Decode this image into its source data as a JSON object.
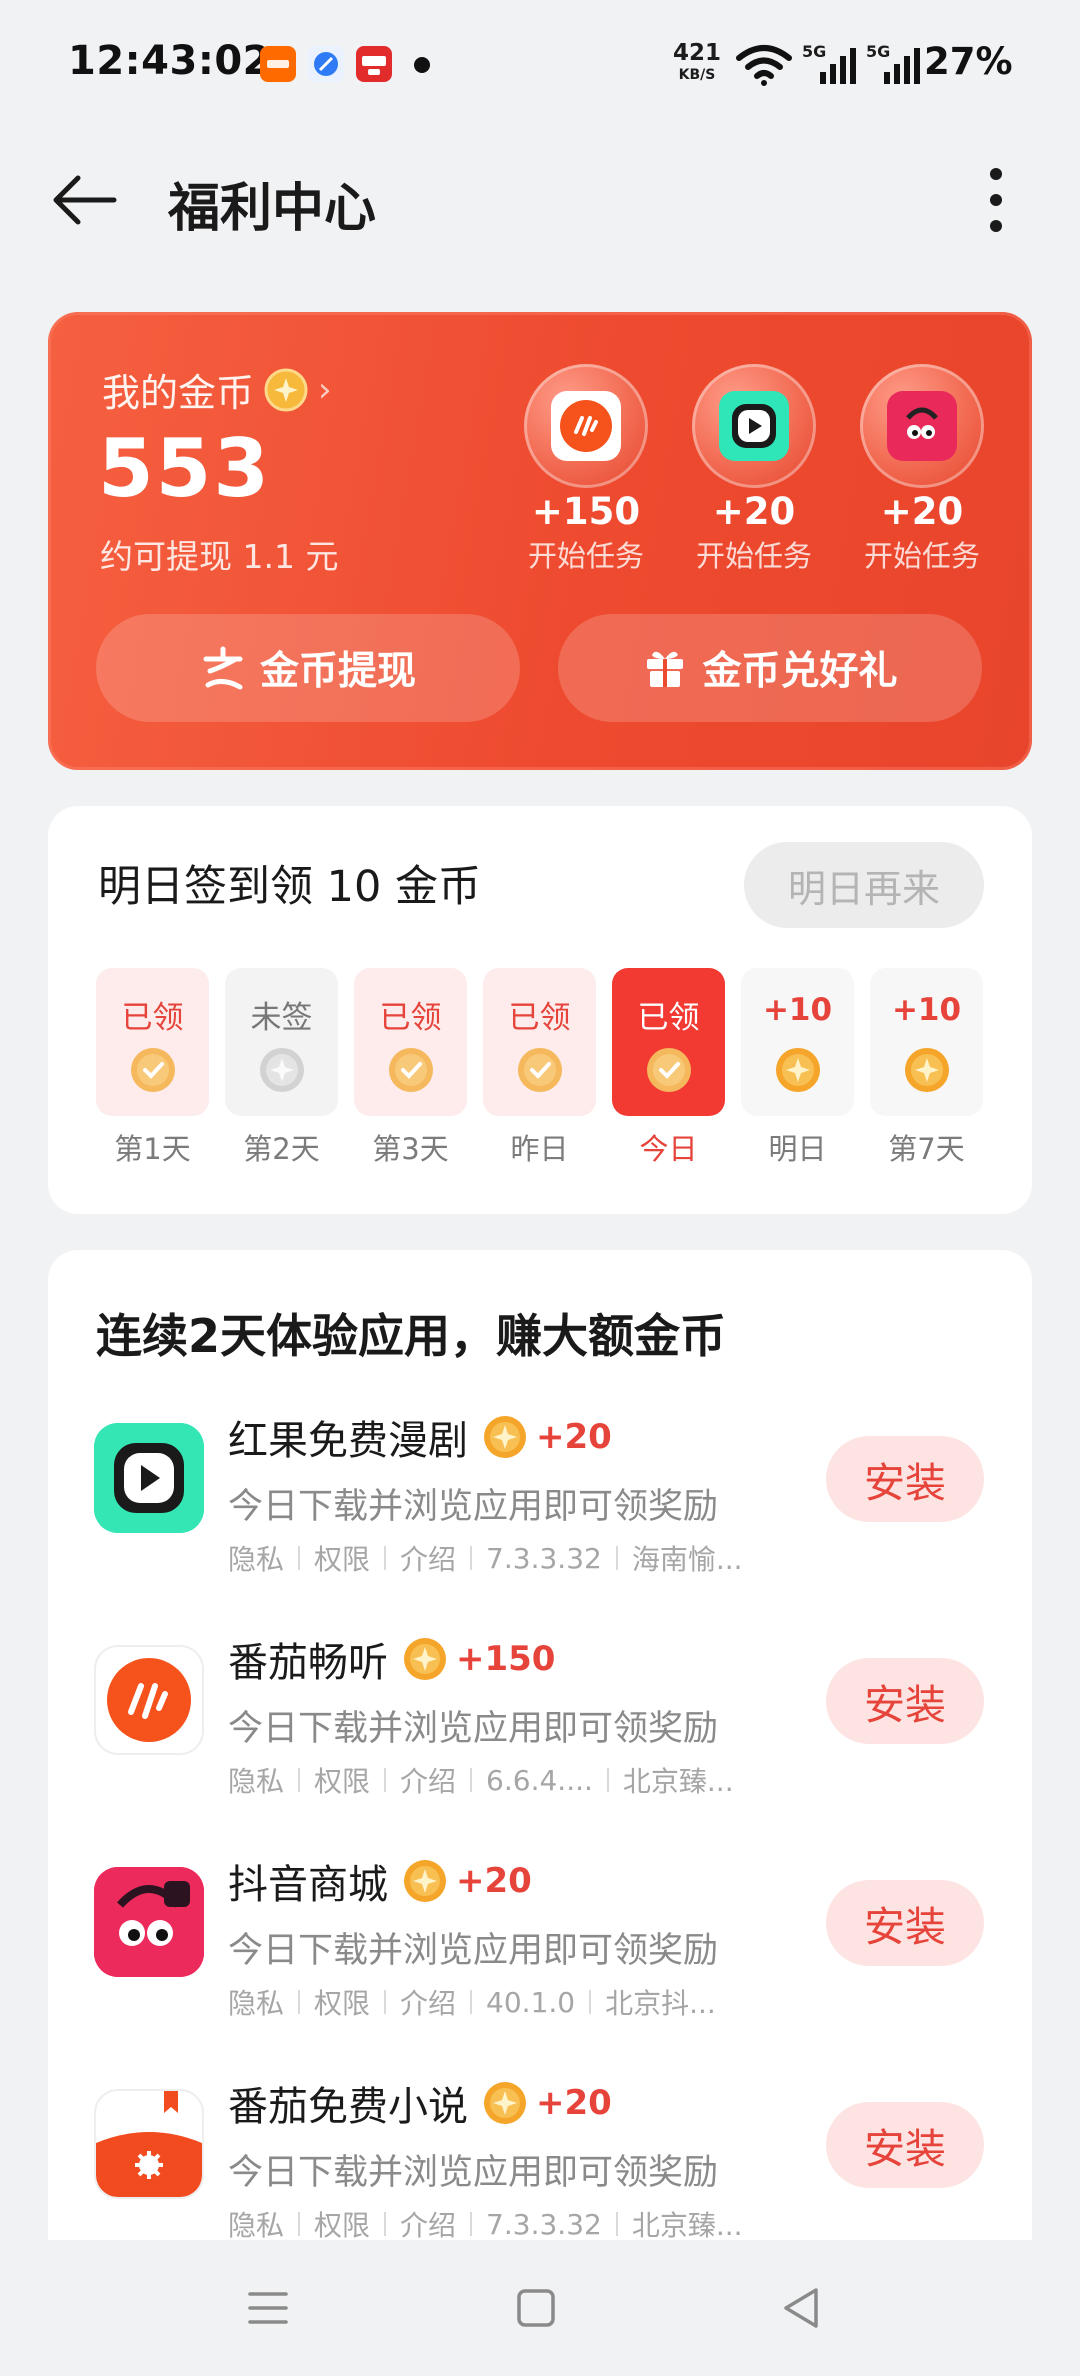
{
  "status_bar": {
    "time": "12:43:02",
    "net_speed_value": "421",
    "net_speed_unit": "KB/S",
    "sim1_tag": "5G",
    "sim2_tag": "5G",
    "battery": "27%",
    "notification_icons": [
      "taobao-flash-icon",
      "browser-icon",
      "pinduoduo-pay-icon"
    ]
  },
  "top_bar": {
    "title": "福利中心"
  },
  "coin_card": {
    "label": "我的金币",
    "amount": "553",
    "withdraw_estimate": "约可提现 1.1 元",
    "tasks": [
      {
        "app": "fanqie-listen",
        "reward": "+150",
        "cta": "开始任务"
      },
      {
        "app": "hongguo-drama",
        "reward": "+20",
        "cta": "开始任务"
      },
      {
        "app": "douyin-mall",
        "reward": "+20",
        "cta": "开始任务"
      }
    ],
    "withdraw_button": "金币提现",
    "gift_button": "金币兑好礼"
  },
  "checkin": {
    "title": "明日签到领 10 金币",
    "button": "明日再来",
    "days": [
      {
        "status": "已领",
        "label": "第1天"
      },
      {
        "status": "未签",
        "label": "第2天"
      },
      {
        "status": "已领",
        "label": "第3天"
      },
      {
        "status": "已领",
        "label": "昨日"
      },
      {
        "status": "已领",
        "label": "今日"
      },
      {
        "status": "+10",
        "label": "明日"
      },
      {
        "status": "+10",
        "label": "第7天"
      }
    ]
  },
  "promo": {
    "title": "连续2天体验应用，赚大额金币",
    "meta_labels": [
      "隐私",
      "权限",
      "介绍"
    ],
    "install_label": "安装",
    "apps": [
      {
        "name": "红果免费漫剧",
        "reward": "+20",
        "desc": "今日下载并浏览应用即可领奖励",
        "version": "7.3.3.32",
        "developer": "海南愉..."
      },
      {
        "name": "番茄畅听",
        "reward": "+150",
        "desc": "今日下载并浏览应用即可领奖励",
        "version": "6.6.4....",
        "developer": "北京臻..."
      },
      {
        "name": "抖音商城",
        "reward": "+20",
        "desc": "今日下载并浏览应用即可领奖励",
        "version": "40.1.0",
        "developer": "北京抖..."
      },
      {
        "name": "番茄免费小说",
        "reward": "+20",
        "desc": "今日下载并浏览应用即可领奖励",
        "version": "7.3.3.32",
        "developer": "北京臻..."
      }
    ]
  },
  "colors": {
    "accent_red": "#e6433a",
    "card_orange": "#ee4a2f",
    "page_bg": "#f1f2f4"
  }
}
